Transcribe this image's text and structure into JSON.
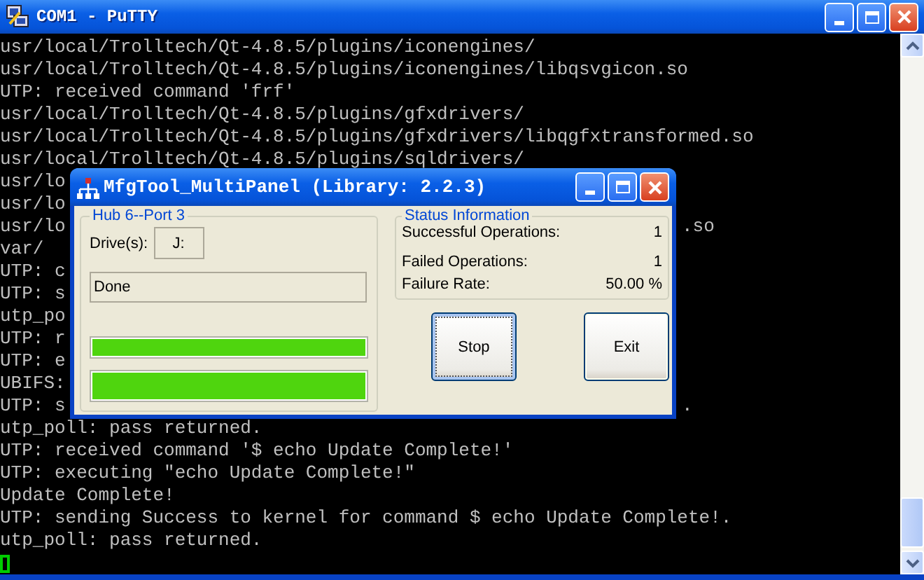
{
  "window": {
    "title": "COM1 - PuTTY"
  },
  "terminal": {
    "lines": [
      {
        "text": "usr/local/Trolltech/Qt-4.8.5/plugins/iconengines/"
      },
      {
        "text": "usr/local/Trolltech/Qt-4.8.5/plugins/iconengines/libqsvgicon.so"
      },
      {
        "text": "UTP: received command 'frf'"
      },
      {
        "text": "usr/local/Trolltech/Qt-4.8.5/plugins/gfxdrivers/"
      },
      {
        "text": "usr/local/Trolltech/Qt-4.8.5/plugins/gfxdrivers/libqgfxtransformed.so"
      },
      {
        "text": "usr/local/Trolltech/Qt-4.8.5/plugins/sqldrivers/"
      },
      {
        "text": "usr/lo"
      },
      {
        "text": "usr/lo"
      },
      {
        "text": "usr/lo",
        "tail": ".so"
      },
      {
        "text": "var/"
      },
      {
        "text": "UTP: c"
      },
      {
        "text": "UTP: s"
      },
      {
        "text": "utp_po"
      },
      {
        "text": "UTP: r"
      },
      {
        "text": "UTP: e"
      },
      {
        "text": "UBIFS:"
      },
      {
        "text": "UTP: s",
        "tail": "."
      },
      {
        "text": "utp_poll: pass returned."
      },
      {
        "text": "UTP: received command '$ echo Update Complete!'"
      },
      {
        "text": "UTP: executing \"echo Update Complete!\""
      },
      {
        "text": "Update Complete!"
      },
      {
        "text": "UTP: sending Success to kernel for command $ echo Update Complete!."
      },
      {
        "text": "utp_poll: pass returned."
      }
    ],
    "cursor": true
  },
  "dialog": {
    "title": "MfgTool_MultiPanel (Library: 2.2.3)",
    "hub_group": {
      "title": "Hub 6--Port 3",
      "drive_label": "Drive(s):",
      "drive_value": "J:",
      "status_text": "Done",
      "progress": [
        {
          "level": 1
        },
        {
          "level": 1
        }
      ]
    },
    "status_group": {
      "title": "Status Information",
      "rows": [
        {
          "label": "Successful Operations:",
          "value": "1"
        },
        {
          "label": "Failed Operations:",
          "value": "1"
        },
        {
          "label": "Failure Rate:",
          "value": "50.00 %"
        }
      ]
    },
    "buttons": [
      {
        "label": "Stop",
        "focused": true
      },
      {
        "label": "Exit",
        "focused": false
      }
    ]
  }
}
